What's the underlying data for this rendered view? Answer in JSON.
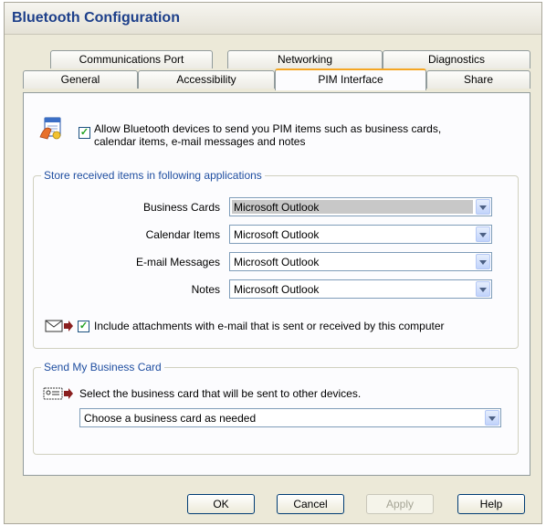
{
  "window": {
    "title": "Bluetooth Configuration"
  },
  "tabs": {
    "row1": [
      "Communications Port",
      "Networking",
      "Diagnostics"
    ],
    "row2": [
      "General",
      "Accessibility",
      "PIM Interface",
      "Share"
    ],
    "active": "PIM Interface"
  },
  "pim": {
    "allow_label": "Allow Bluetooth devices to send you PIM items such as business cards, calendar items, e-mail messages and notes",
    "allow_line1": "Allow Bluetooth devices to send you PIM items such as business cards,",
    "allow_line2": "calendar items, e-mail messages and notes",
    "allow_checked": true
  },
  "store": {
    "legend": "Store received items in following applications",
    "rows": [
      {
        "label": "Business Cards",
        "value": "Microsoft Outlook"
      },
      {
        "label": "Calendar Items",
        "value": "Microsoft Outlook"
      },
      {
        "label": "E-mail Messages",
        "value": "Microsoft Outlook"
      },
      {
        "label": "Notes",
        "value": "Microsoft Outlook"
      }
    ],
    "attachments_label": "Include attachments with e-mail that is sent or received by this computer",
    "attachments_checked": true
  },
  "send": {
    "legend": "Send My Business Card",
    "description": "Select the business card that will be sent to other devices.",
    "select_value": "Choose a business card as needed"
  },
  "buttons": {
    "ok": "OK",
    "cancel": "Cancel",
    "apply": "Apply",
    "help": "Help"
  },
  "colors": {
    "accent": "#1f4ea0",
    "tab_highlight": "#f5a623",
    "checkmark": "#21a121",
    "title": "#1d3f8a"
  },
  "icons": [
    "pim-icon",
    "envelope-arrow-icon",
    "business-card-arrow-icon",
    "check-icon",
    "chevron-down-icon"
  ]
}
